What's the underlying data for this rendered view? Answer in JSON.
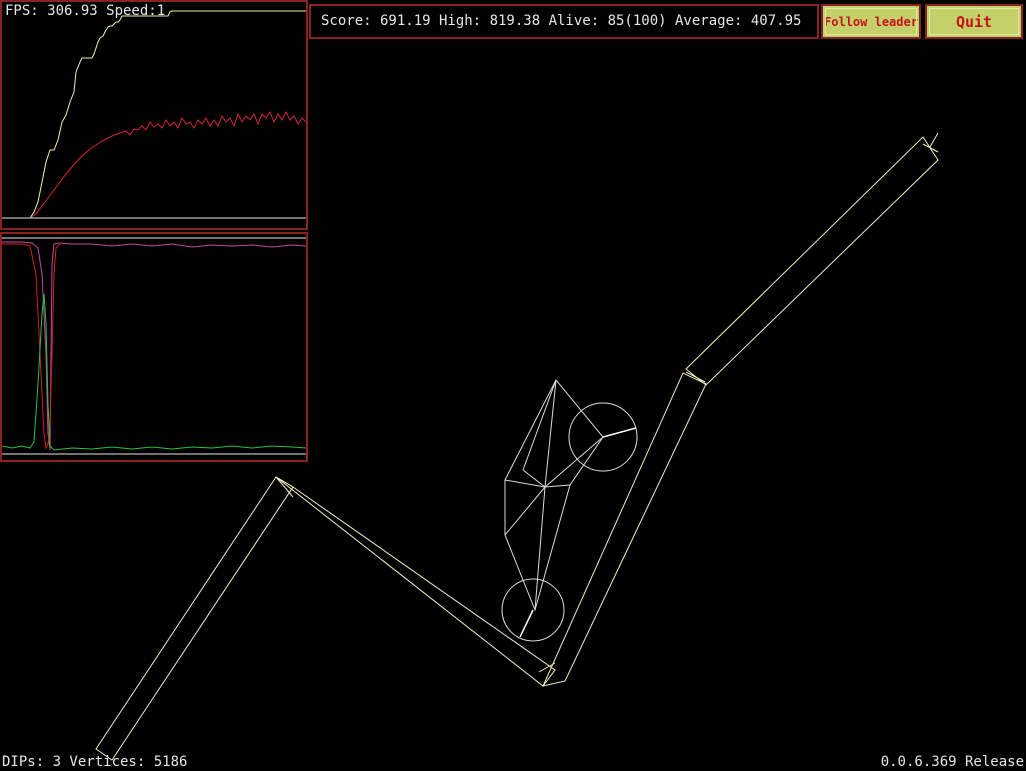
{
  "hud": {
    "fps_text": "FPS: 306.93 Speed:1",
    "score_text": "Score: 691.19 High: 819.38 Alive: 85(100) Average: 407.95"
  },
  "buttons": {
    "follow_leader": "Follow leader",
    "quit": "Quit"
  },
  "footer": {
    "stats": "DIPs: 3 Vertices: 5186",
    "version": "0.0.6.369 Release"
  },
  "colors": {
    "panel_border": "#8b2222",
    "button_bg": "#c4d06a",
    "button_text": "#c8121a",
    "high_score_series": "#f2f2a8",
    "average_score_series": "#d0283a",
    "pink_series": "#c04aa0",
    "red_series": "#d02020",
    "green_series": "#30c040",
    "terrain": "#f0f0c0",
    "vehicle": "#dcdcdc"
  }
}
